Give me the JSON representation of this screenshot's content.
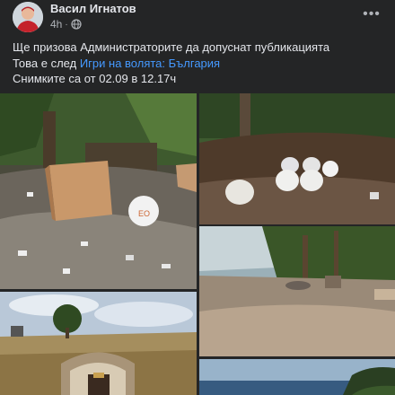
{
  "post": {
    "author": "Васил Игнатов",
    "time": "4h",
    "separator": "·",
    "privacy_icon": "globe-icon",
    "more_icon": "more-options-icon",
    "more_label": "•••",
    "lines": {
      "line1": "Ще призова Администраторите да допуснат публикацията",
      "line2_prefix": "Това е след ",
      "line2_link": "Игри на волята: България",
      "line3": "Снимките са от 02.09 в 12.17ч"
    }
  },
  "photos": [
    {
      "name": "photo-debris-box",
      "description_icon": "photo"
    },
    {
      "name": "photo-eggs-on-dirt",
      "description_icon": "photo"
    },
    {
      "name": "photo-clearing-with-trees",
      "description_icon": "photo"
    },
    {
      "name": "photo-field-with-hut",
      "description_icon": "photo"
    },
    {
      "name": "photo-sea-coast",
      "description_icon": "photo"
    }
  ],
  "colors": {
    "background": "#242526",
    "text": "#e4e6eb",
    "secondary": "#b0b3b8",
    "link": "#4599ff"
  }
}
